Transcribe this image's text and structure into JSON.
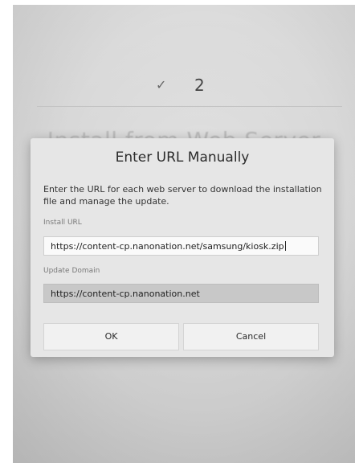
{
  "background": {
    "step_number": "2",
    "ghost_title": "Install from Web Server"
  },
  "icons": {
    "step_check": "check-icon"
  },
  "dialog": {
    "title": "Enter URL Manually",
    "description": "Enter the URL for each web server to download the installation file and manage the update.",
    "install_url": {
      "label": "Install URL",
      "value": "https://content-cp.nanonation.net/samsung/kiosk.zip"
    },
    "update_domain": {
      "label": "Update Domain",
      "value": "https://content-cp.nanonation.net"
    },
    "buttons": {
      "ok": "OK",
      "cancel": "Cancel"
    }
  },
  "colors": {
    "screen_background": "#d6d6d6",
    "dialog_background": "#e6e6e6",
    "button_background": "#f1f1f1",
    "disabled_field": "#c8c8c8"
  }
}
